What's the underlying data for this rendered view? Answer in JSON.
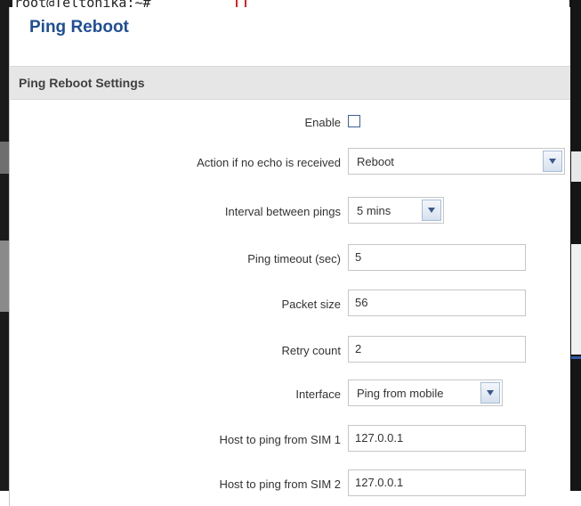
{
  "background": {
    "terminal_text": "root@Teltonika:~# "
  },
  "dialog": {
    "title": "Ping Reboot",
    "section_title": "Ping Reboot Settings"
  },
  "form": {
    "enable_label": "Enable",
    "enable_checked": false,
    "action_label": "Action if no echo is received",
    "action_value": "Reboot",
    "interval_label": "Interval between pings",
    "interval_value": "5 mins",
    "timeout_label": "Ping timeout (sec)",
    "timeout_value": "5",
    "packet_size_label": "Packet size",
    "packet_size_value": "56",
    "retry_label": "Retry count",
    "retry_value": "2",
    "interface_label": "Interface",
    "interface_value": "Ping from mobile",
    "host_sim1_label": "Host to ping from SIM 1",
    "host_sim1_value": "127.0.0.1",
    "host_sim2_label": "Host to ping from SIM 2",
    "host_sim2_value": "127.0.0.1"
  },
  "colors": {
    "title_blue": "#1f4e96",
    "section_bg": "#e6e6e6",
    "checkbox_border": "#3c5f9a"
  },
  "icons": {
    "select_arrow": "chevron-down-icon"
  }
}
